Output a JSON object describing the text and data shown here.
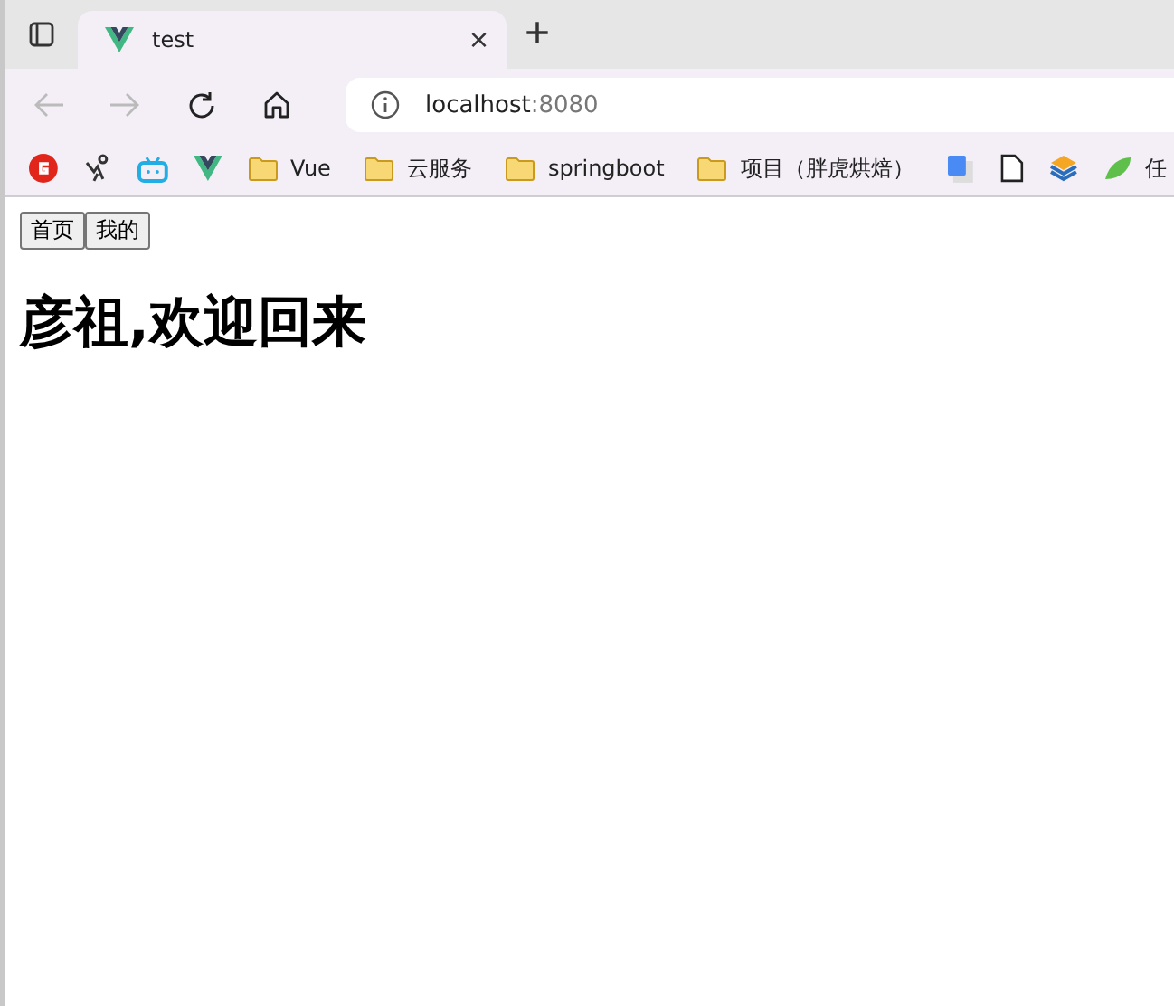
{
  "tab": {
    "title": "test",
    "close": "×",
    "new_tab": "+"
  },
  "address": {
    "host": "localhost",
    "port": ":8080"
  },
  "bookmarks": [
    {
      "kind": "folder",
      "label": "Vue"
    },
    {
      "kind": "folder",
      "label": "云服务"
    },
    {
      "kind": "folder",
      "label": "springboot"
    },
    {
      "kind": "folder",
      "label": "项目（胖虎烘焙）"
    },
    {
      "kind": "site",
      "label": "任"
    }
  ],
  "nav_buttons": [
    {
      "label": "首页"
    },
    {
      "label": "我的"
    }
  ],
  "heading": "彦祖,欢迎回来"
}
